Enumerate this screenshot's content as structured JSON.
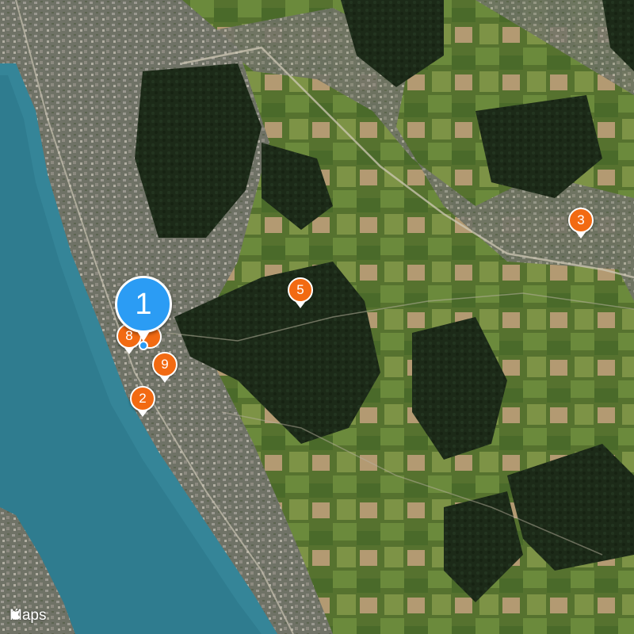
{
  "map": {
    "type": "satellite",
    "colors": {
      "water": "#2f7c8f",
      "forest": "#1c2a18",
      "field": "#5f7a3a",
      "urban": "#7b7a72",
      "marker_orange": "#f26a12",
      "marker_blue": "#2b9cf4"
    }
  },
  "markers": [
    {
      "label": "1",
      "kind": "primary-selected",
      "icon": "map-pin-icon"
    },
    {
      "label": "2",
      "kind": "orange",
      "icon": "map-pin-icon"
    },
    {
      "label": "3",
      "kind": "orange",
      "icon": "map-pin-icon"
    },
    {
      "label": "5",
      "kind": "orange",
      "icon": "map-pin-icon"
    },
    {
      "label": "8",
      "kind": "orange-cluster",
      "icon": "map-pin-icon"
    },
    {
      "label": "9",
      "kind": "orange",
      "icon": "map-pin-icon"
    }
  ],
  "attribution": {
    "text": "Maps",
    "icon": "apple-logo-icon"
  }
}
